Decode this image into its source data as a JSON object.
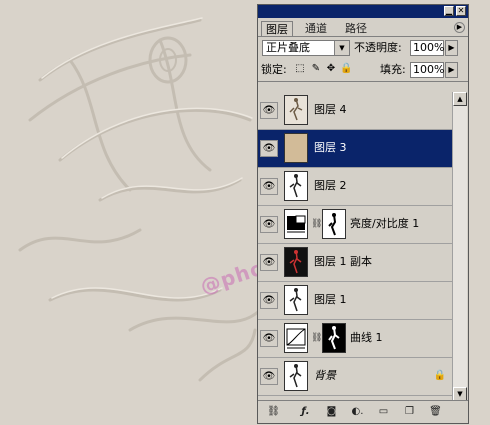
{
  "watermark": "@photoshop资源库",
  "panel": {
    "tabs": [
      {
        "label": "图层",
        "active": true
      },
      {
        "label": "通道",
        "active": false
      },
      {
        "label": "路径",
        "active": false
      }
    ],
    "blend_mode": "正片叠底",
    "opacity_label": "不透明度:",
    "opacity_value": "100%",
    "lock_label": "锁定:",
    "fill_label": "填充:",
    "fill_value": "100%",
    "lock_icons": [
      "transparency-lock-icon",
      "brush-lock-icon",
      "move-lock-icon",
      "padlock-icon"
    ],
    "layers": [
      {
        "name": "图层 4",
        "kind": "image",
        "selected": false
      },
      {
        "name": "图层 3",
        "kind": "fill",
        "selected": true
      },
      {
        "name": "图层 2",
        "kind": "image",
        "selected": false
      },
      {
        "name": "亮度/对比度 1",
        "kind": "adjust-brightness",
        "selected": false
      },
      {
        "name": "图层 1 副本",
        "kind": "image-dark",
        "selected": false
      },
      {
        "name": "图层 1",
        "kind": "image",
        "selected": false
      },
      {
        "name": "曲线 1",
        "kind": "adjust-curves",
        "selected": false
      },
      {
        "name": "背景",
        "kind": "image",
        "selected": false,
        "locked": true
      }
    ],
    "bottom_icons": [
      "link-icon",
      "layer-style-icon",
      "mask-icon",
      "adjustment-layer-icon",
      "new-group-icon",
      "new-layer-icon",
      "trash-icon"
    ],
    "colors": {
      "titlebar": "#0a246a",
      "selected": "#0a246a",
      "panel": "#d4d0c8",
      "layer3_fill": "#d2bb98"
    }
  }
}
